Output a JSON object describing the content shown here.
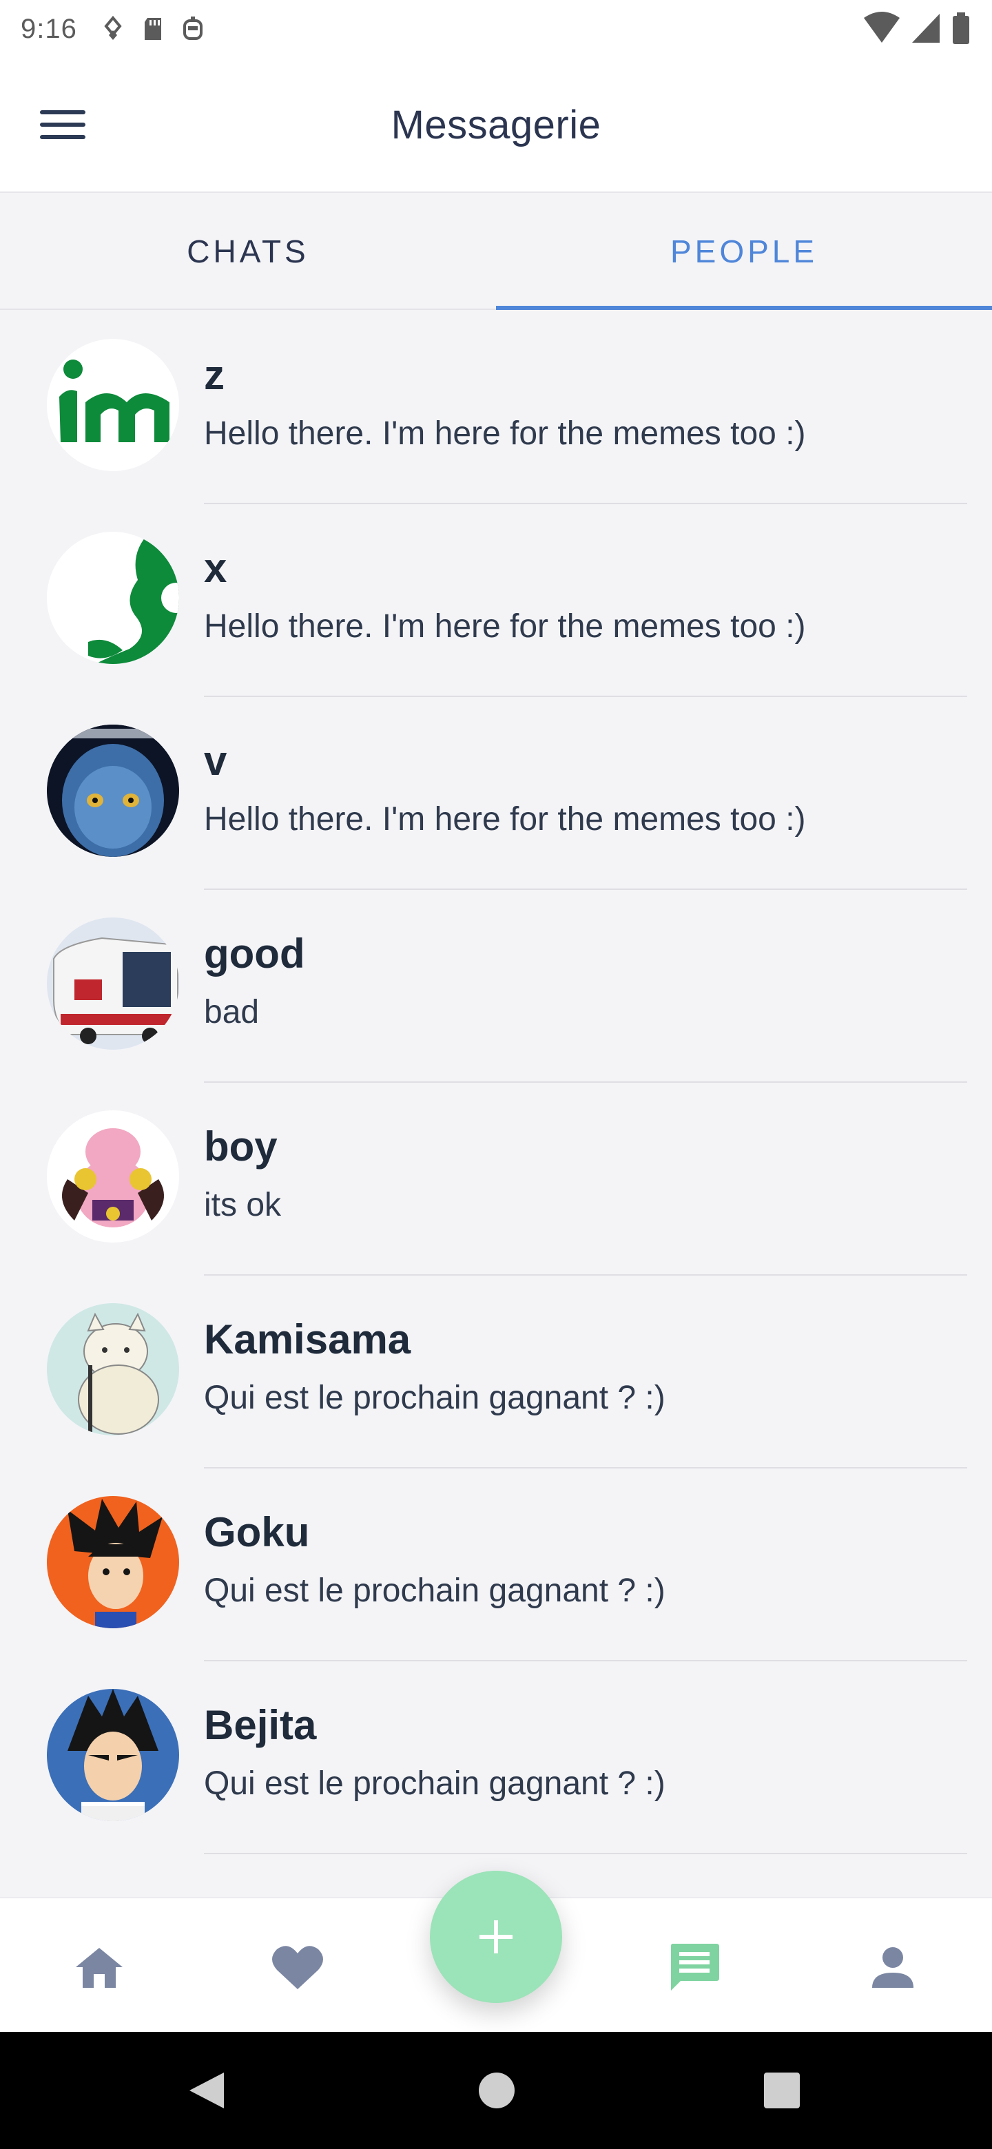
{
  "status": {
    "time": "9:16"
  },
  "app": {
    "title": "Messagerie"
  },
  "tabs": [
    {
      "label": "CHATS",
      "active": false
    },
    {
      "label": "PEOPLE",
      "active": true
    }
  ],
  "contacts": [
    {
      "name": "z",
      "message": "Hello there. I'm here for the memes too :)"
    },
    {
      "name": "x",
      "message": "Hello there. I'm here for the memes too :)"
    },
    {
      "name": "v",
      "message": "Hello there. I'm here for the memes too :)"
    },
    {
      "name": "good",
      "message": "bad"
    },
    {
      "name": "boy",
      "message": "its ok"
    },
    {
      "name": "Kamisama",
      "message": "Qui est le prochain gagnant ? :)"
    },
    {
      "name": "Goku",
      "message": "Qui est le prochain gagnant ? :)"
    },
    {
      "name": "Bejita",
      "message": "Qui est le prochain gagnant ? :)"
    }
  ],
  "bottom_nav": {
    "items": [
      "home-icon",
      "heart-icon",
      "add-icon",
      "chat-icon",
      "person-icon"
    ],
    "active": "chat-icon"
  },
  "colors": {
    "accent": "#4f86d9",
    "fab": "#9be3b8",
    "nav_active": "#7fd3a0",
    "nav_inactive": "#7b86a2",
    "background": "#f4f4f7"
  }
}
